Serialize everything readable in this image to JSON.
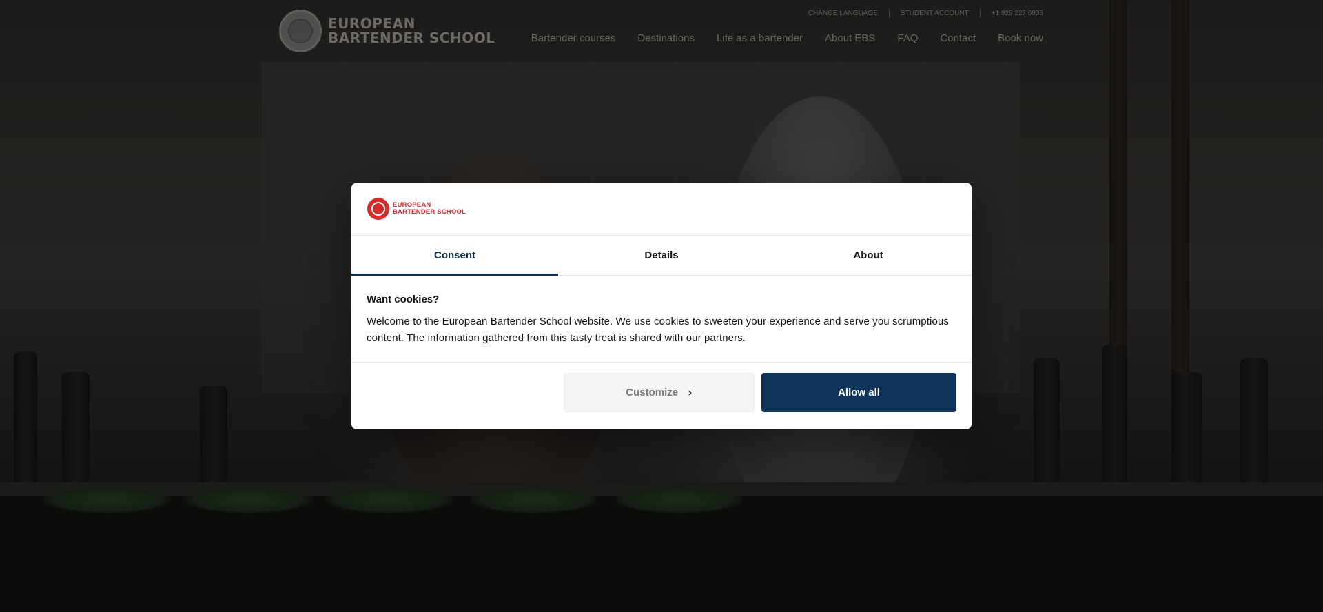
{
  "site": {
    "logo_line1": "EUROPEAN",
    "logo_line2": "BARTENDER SCHOOL",
    "utility_nav": [
      "CHANGE LANGUAGE",
      "STUDENT ACCOUNT",
      "+1 929 227 6936"
    ],
    "main_nav": [
      "Bartender courses",
      "Destinations",
      "Life as a bartender",
      "About EBS",
      "FAQ",
      "Contact",
      "Book now"
    ]
  },
  "cookie_dialog": {
    "logo_line1": "EUROPEAN",
    "logo_line2": "BARTENDER SCHOOL",
    "tabs": [
      "Consent",
      "Details",
      "About"
    ],
    "active_tab": "Consent",
    "heading": "Want cookies?",
    "heading_emoji": "",
    "message": "Welcome to the European Bartender School website. We use cookies to sweeten your experience and serve you scrumptious content. The information gathered from this tasty treat is shared with our partners.",
    "customize_label": "Customize",
    "allow_all_label": "Allow all"
  },
  "colors": {
    "brand_red": "#d42b2b",
    "primary_navy": "#0d3458"
  },
  "icons": {
    "customize": "chevron-right-icon"
  }
}
